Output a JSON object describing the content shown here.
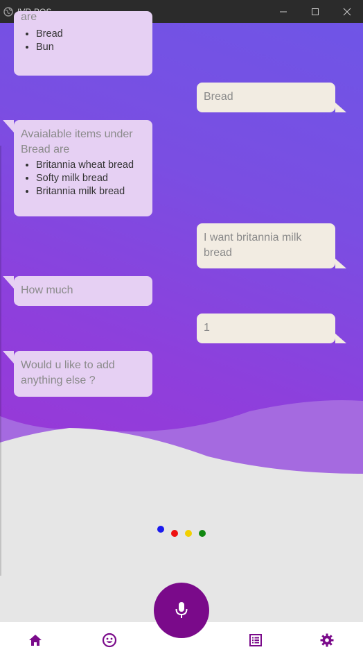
{
  "window": {
    "title": "IVR-POS"
  },
  "messages": [
    {
      "from": "bot",
      "text": "are",
      "items": [
        "Bread",
        "Bun"
      ]
    },
    {
      "from": "user",
      "text": "Bread"
    },
    {
      "from": "bot",
      "text": "Avaialable items under Bread are",
      "items": [
        "Britannia wheat bread",
        "Softy milk bread",
        "Britannia milk bread"
      ]
    },
    {
      "from": "user",
      "text": "I want britannia milk bread"
    },
    {
      "from": "bot",
      "text": "How much"
    },
    {
      "from": "user",
      "text": "1"
    },
    {
      "from": "bot",
      "text": "Would u like to add anything else ?"
    }
  ],
  "listening_dots": {
    "colors": [
      "#1a1aee",
      "#ee1111",
      "#f2d000",
      "#118811"
    ]
  },
  "nav": {
    "icons": [
      "home-icon",
      "smiley-icon",
      "microphone-icon",
      "list-icon",
      "gear-icon"
    ],
    "accent": "#7a0a8a"
  },
  "colors": {
    "bot_bubble": "#e6d0f3",
    "user_bubble": "#f2ece2",
    "gradient_start": "#6f55e6",
    "gradient_end": "#9a37d6"
  }
}
